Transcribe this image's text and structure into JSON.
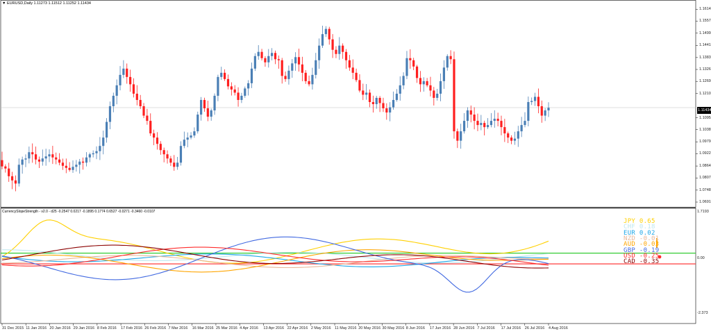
{
  "header": {
    "symbol_label": "EURUSD,Daily",
    "ohlc": "1.11273 1.11512 1.11252 1.11434"
  },
  "indicator": {
    "title": "CurrencySlopeStrength - v2.0 - d25 -0.2547 0.0217 -0.1895 0.1774 0.6527 -0.0271 -0.3460 -0.0107",
    "axis_top": "1.7193",
    "axis_mid": "0.00",
    "axis_bottom": "-2.373",
    "legend": [
      {
        "name": "JPY",
        "value": "0.65",
        "color": "#ffd000"
      },
      {
        "name": "CHF",
        "value": "0.18",
        "color": "#bfe7ef"
      },
      {
        "name": "EUR",
        "value": "0.02",
        "color": "#1ea7e8"
      },
      {
        "name": "NZD",
        "value": "-0.01",
        "color": "#e8b89a"
      },
      {
        "name": "AUD",
        "value": "-0.03",
        "color": "#ffa500"
      },
      {
        "name": "GBP",
        "value": "-0.19",
        "color": "#4169e1"
      },
      {
        "name": "USD",
        "value": "-0.25",
        "color": "#ff2b2b"
      },
      {
        "name": "CAD",
        "value": "-0.35",
        "color": "#8b0000"
      }
    ],
    "levels": {
      "upper_color": "#32cd32",
      "lower_color": "#ff3c3c"
    }
  },
  "price_axis": [
    "1.16140",
    "1.15570",
    "1.14995",
    "1.14415",
    "1.13830",
    "1.13260",
    "1.12690",
    "1.12105",
    "1.10950",
    "1.10380",
    "1.09790",
    "1.09225",
    "1.08640",
    "1.08070",
    "1.07485",
    "1.06915"
  ],
  "current_price": "1.11434",
  "dates": [
    "31 Dec 2015",
    "11 Jan 2016",
    "20 Jan 2016",
    "29 Jan 2016",
    "8 Feb 2016",
    "17 Feb 2016",
    "26 Feb 2016",
    "7 Mar 2016",
    "16 Mar 2016",
    "25 Mar 2016",
    "4 Apr 2016",
    "13 Apr 2016",
    "22 Apr 2016",
    "2 May 2016",
    "11 May 2016",
    "20 May 2016",
    "30 May 2016",
    "8 Jun 2016",
    "17 Jun 2016",
    "28 Jun 2016",
    "7 Jul 2016",
    "17 Jul 2016",
    "26 Jul 2016",
    "4 Aug 2016"
  ],
  "colors": {
    "bull": "#4a7fb5",
    "bear": "#ff1f1f",
    "grid": "#c8c8c8"
  },
  "chart_data": {
    "type": "candlestick",
    "ylim": [
      1.0675,
      1.1645
    ],
    "close_series": [
      1.0862,
      1.0852,
      1.0815,
      1.0795,
      1.078,
      1.087,
      1.0895,
      1.09,
      1.093,
      1.092,
      1.0895,
      1.0885,
      1.09,
      1.091,
      1.092,
      1.0905,
      1.0895,
      1.088,
      1.0865,
      1.0855,
      1.0845,
      1.086,
      1.087,
      1.0885,
      1.088,
      1.0905,
      1.092,
      1.0925,
      1.0935,
      1.096,
      1.1,
      1.1075,
      1.115,
      1.12,
      1.125,
      1.13,
      1.133,
      1.129,
      1.1255,
      1.121,
      1.118,
      1.115,
      1.1105,
      1.108,
      1.102,
      1.1,
      1.097,
      1.094,
      1.092,
      1.09,
      1.088,
      1.086,
      1.088,
      1.096,
      1.099,
      1.1,
      1.101,
      1.103,
      1.111,
      1.118,
      1.114,
      1.11,
      1.113,
      1.12,
      1.129,
      1.131,
      1.128,
      1.1245,
      1.123,
      1.1215,
      1.118,
      1.12,
      1.1235,
      1.126,
      1.133,
      1.139,
      1.141,
      1.138,
      1.136,
      1.139,
      1.1405,
      1.1375,
      1.137,
      1.1295,
      1.128,
      1.132,
      1.1355,
      1.1385,
      1.135,
      1.131,
      1.127,
      1.1255,
      1.13,
      1.137,
      1.144,
      1.1495,
      1.152,
      1.147,
      1.142,
      1.14,
      1.144,
      1.141,
      1.137,
      1.1335,
      1.131,
      1.1275,
      1.1225,
      1.1205,
      1.1215,
      1.117,
      1.116,
      1.119,
      1.1165,
      1.114,
      1.112,
      1.1145,
      1.118,
      1.121,
      1.125,
      1.1295,
      1.138,
      1.137,
      1.134,
      1.1285,
      1.1255,
      1.127,
      1.125,
      1.1225,
      1.119,
      1.121,
      1.127,
      1.1335,
      1.139,
      1.1375,
      1.103,
      1.0985,
      1.103,
      1.108,
      1.113,
      1.111,
      1.108,
      1.106,
      1.107,
      1.105,
      1.106,
      1.108,
      1.109,
      1.108,
      1.105,
      1.102,
      1.1,
      1.0985,
      1.0995,
      1.103,
      1.106,
      1.108,
      1.117,
      1.1175,
      1.1195,
      1.115,
      1.1105,
      1.113,
      1.1143
    ]
  },
  "indicator_data": {
    "n": 160,
    "ylim": [
      -2.373,
      1.7193
    ],
    "levels": [
      0.2,
      -0.2
    ]
  }
}
